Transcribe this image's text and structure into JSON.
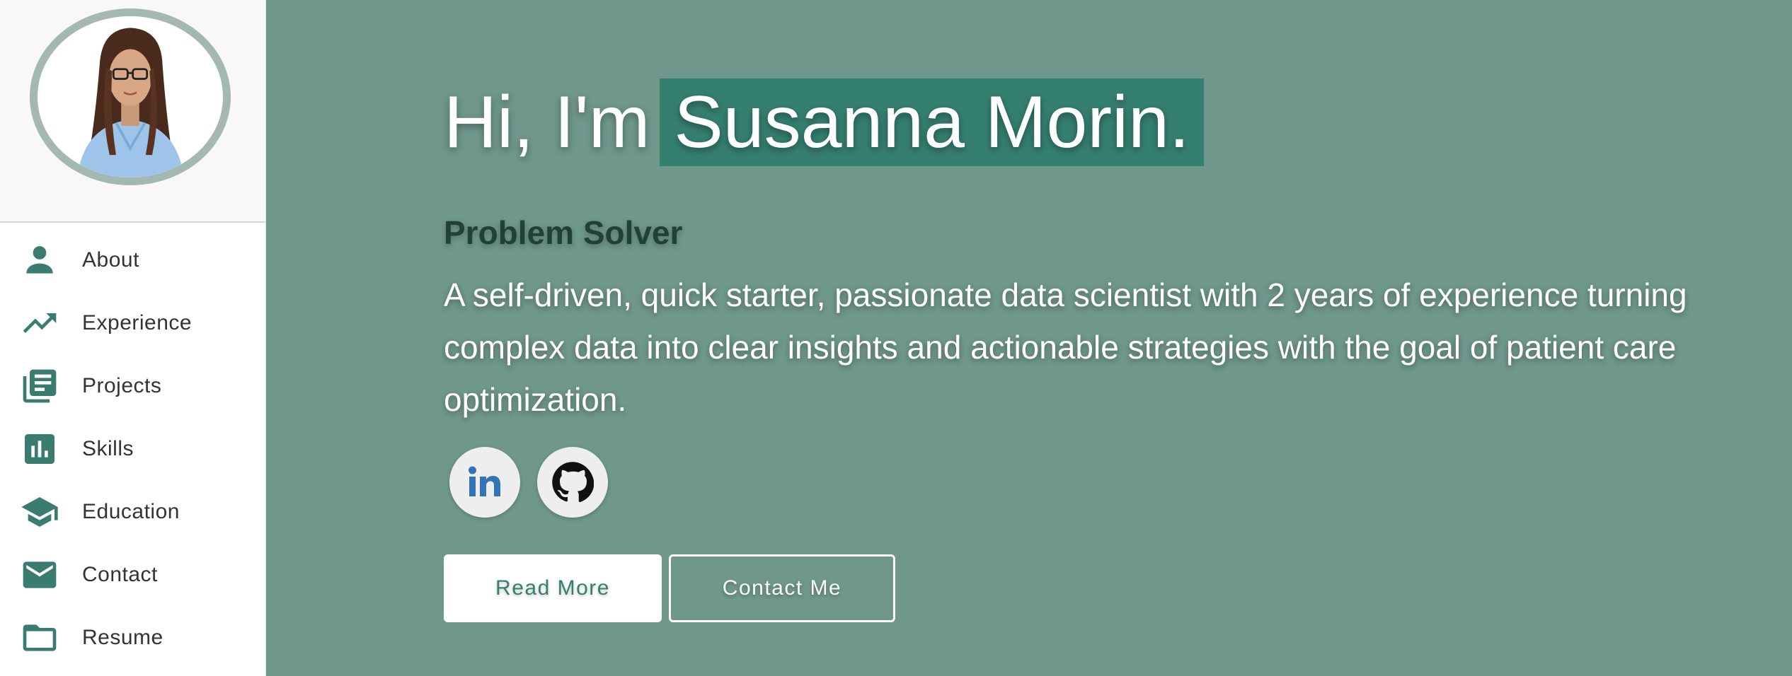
{
  "sidebar": {
    "items": [
      {
        "label": "About",
        "icon": "person-icon"
      },
      {
        "label": "Experience",
        "icon": "trending-up-icon"
      },
      {
        "label": "Projects",
        "icon": "library-books-icon"
      },
      {
        "label": "Skills",
        "icon": "bar-chart-icon"
      },
      {
        "label": "Education",
        "icon": "school-icon"
      },
      {
        "label": "Contact",
        "icon": "mail-icon"
      },
      {
        "label": "Resume",
        "icon": "folder-icon"
      }
    ]
  },
  "hero": {
    "greeting": "Hi, I'm",
    "name": "Susanna Morin.",
    "subtitle": "Problem Solver",
    "bio": "A self-driven, quick starter, passionate data scientist with 2 years of experience turning complex data into clear insights and actionable strategies with the goal of patient care optimization.",
    "socials": [
      {
        "name": "linkedin-icon"
      },
      {
        "name": "github-icon"
      }
    ],
    "buttons": {
      "read_more": "Read More",
      "contact_me": "Contact Me"
    }
  },
  "colors": {
    "background": "#6f978c",
    "accent": "#357f71",
    "icon": "#3a7d70",
    "avatar_border": "#a3b8b0"
  }
}
